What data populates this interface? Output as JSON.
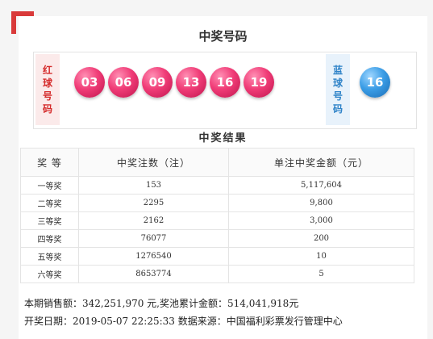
{
  "header": {
    "title": "中奖号码"
  },
  "red_label": [
    "红",
    "球",
    "号",
    "码"
  ],
  "blue_label": [
    "蓝",
    "球",
    "号",
    "码"
  ],
  "red_balls": [
    "03",
    "06",
    "09",
    "13",
    "16",
    "19"
  ],
  "blue_ball": "16",
  "results": {
    "title": "中奖结果",
    "columns": [
      "奖 等",
      "中奖注数（注）",
      "单注中奖金额（元）"
    ],
    "rows": [
      {
        "level": "一等奖",
        "count": "153",
        "amount": "5,117,604"
      },
      {
        "level": "二等奖",
        "count": "2295",
        "amount": "9,800"
      },
      {
        "level": "三等奖",
        "count": "2162",
        "amount": "3,000"
      },
      {
        "level": "四等奖",
        "count": "76077",
        "amount": "200"
      },
      {
        "level": "五等奖",
        "count": "1276540",
        "amount": "10"
      },
      {
        "level": "六等奖",
        "count": "8653774",
        "amount": "5"
      }
    ]
  },
  "summary": {
    "sales_line": "本期销售额：342,251,970 元,奖池累计金额：514,041,918元",
    "draw_line": "开奖日期：2019-05-07 22:25:33 数据来源：中国福利彩票发行管理中心"
  },
  "colors": {
    "red": "#e83c77",
    "blue": "#3b9de6",
    "accent": "#d93a3a"
  }
}
